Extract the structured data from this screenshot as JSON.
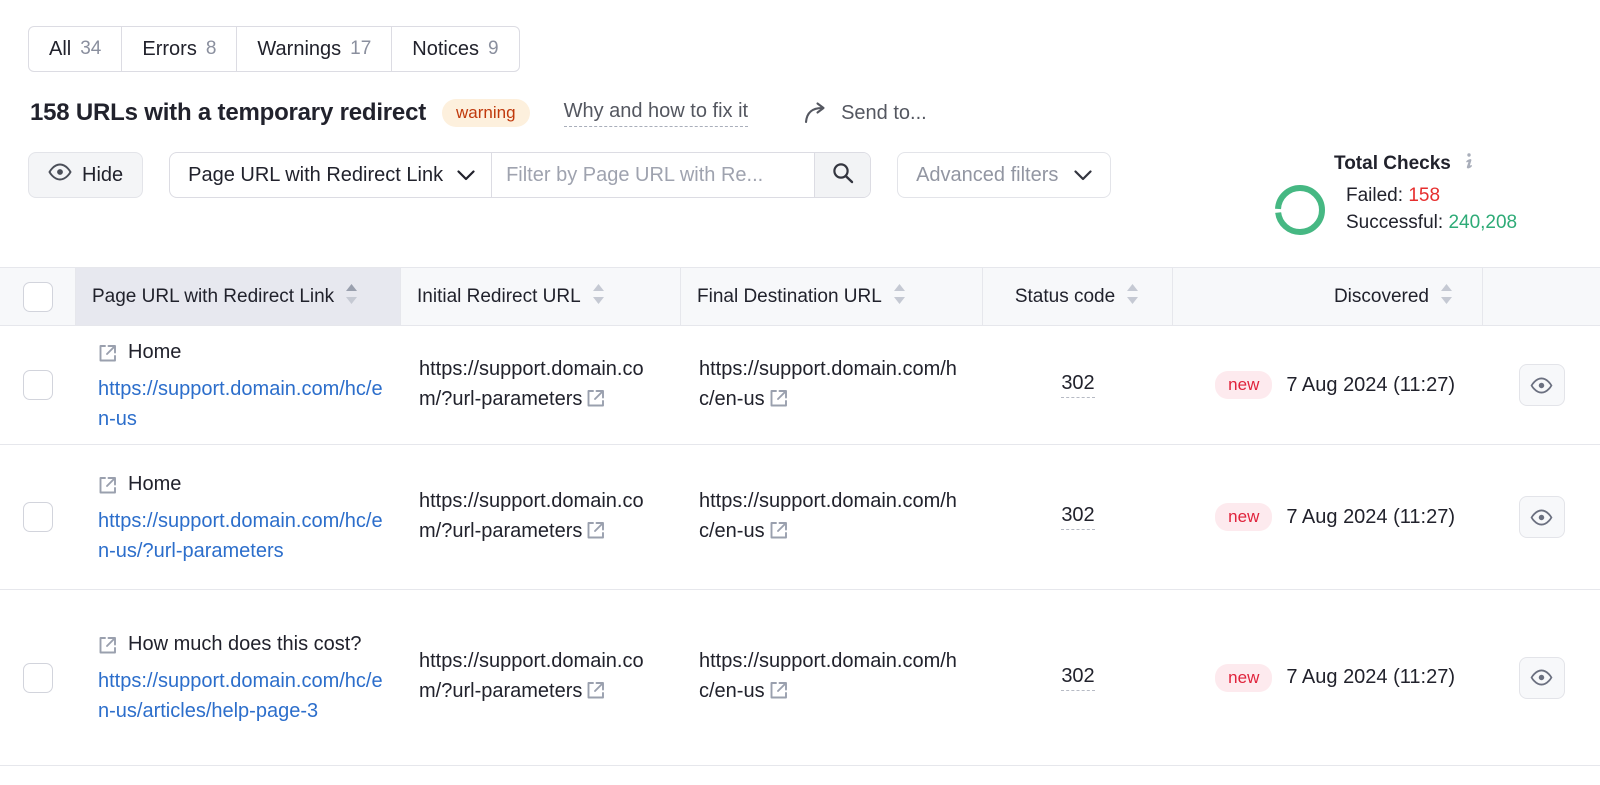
{
  "tabs": [
    {
      "label": "All",
      "count": "34"
    },
    {
      "label": "Errors",
      "count": "8"
    },
    {
      "label": "Warnings",
      "count": "17"
    },
    {
      "label": "Notices",
      "count": "9"
    }
  ],
  "header": {
    "title": "158 URLs with a temporary redirect",
    "badge": "warning",
    "why_link": "Why and how to fix it",
    "send_to": "Send to..."
  },
  "toolbar": {
    "hide_label": "Hide",
    "column_select": "Page URL with Redirect Link",
    "filter_placeholder": "Filter by Page URL with Re...",
    "filter_value": "",
    "advanced_filters": "Advanced filters"
  },
  "total_checks": {
    "title": "Total Checks",
    "failed_label": "Failed:",
    "failed_value": "158",
    "successful_label": "Successful:",
    "successful_value": "240,208",
    "failed_color": "#e62e2e",
    "successful_color": "#2eab77",
    "ring_color": "#46b883"
  },
  "table": {
    "columns": [
      {
        "label": "Page URL with Redirect Link",
        "sorted": true
      },
      {
        "label": "Initial Redirect URL",
        "sorted": false
      },
      {
        "label": "Final Destination URL",
        "sorted": false
      },
      {
        "label": "Status code",
        "sorted": false
      },
      {
        "label": "Discovered",
        "sorted": false
      }
    ],
    "rows": [
      {
        "entity_title": "Home",
        "page_url": "https://support.domain.com/hc/en-us",
        "initial_redirect_url": "https://support.domain.com/?url-parameters",
        "final_destination_url": "https://support.domain.com/hc/en-us",
        "status_code": "302",
        "discovered_badge": "new",
        "discovered_date": "7 Aug 2024 (11:27)"
      },
      {
        "entity_title": "Home",
        "page_url": "https://support.domain.com/hc/en-us/?url-parameters",
        "initial_redirect_url": "https://support.domain.com/?url-parameters",
        "final_destination_url": "https://support.domain.com/hc/en-us",
        "status_code": "302",
        "discovered_badge": "new",
        "discovered_date": "7 Aug 2024 (11:27)"
      },
      {
        "entity_title": "How much does this cost?",
        "page_url": "https://support.domain.com/hc/en-us/articles/help-page-3",
        "initial_redirect_url": "https://support.domain.com/?url-parameters",
        "final_destination_url": "https://support.domain.com/hc/en-us",
        "status_code": "302",
        "discovered_badge": "new",
        "discovered_date": "7 Aug 2024 (11:27)"
      }
    ]
  }
}
